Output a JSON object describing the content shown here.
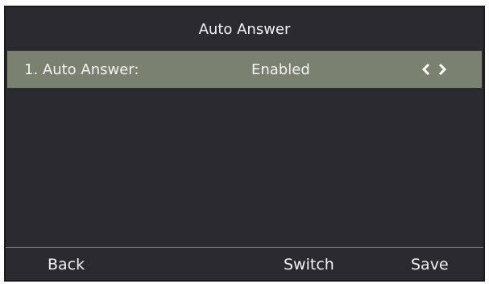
{
  "screen": {
    "title": "Auto Answer"
  },
  "setting": {
    "label": "1. Auto Answer:",
    "value": "Enabled",
    "left_arrow_icon": "chevron-left-icon",
    "right_arrow_icon": "chevron-right-icon"
  },
  "softkeys": {
    "back": "Back",
    "switch": "Switch",
    "save": "Save"
  },
  "colors": {
    "background": "#2b2a31",
    "highlight": "#7a8171",
    "text": "#f2f2f2"
  }
}
